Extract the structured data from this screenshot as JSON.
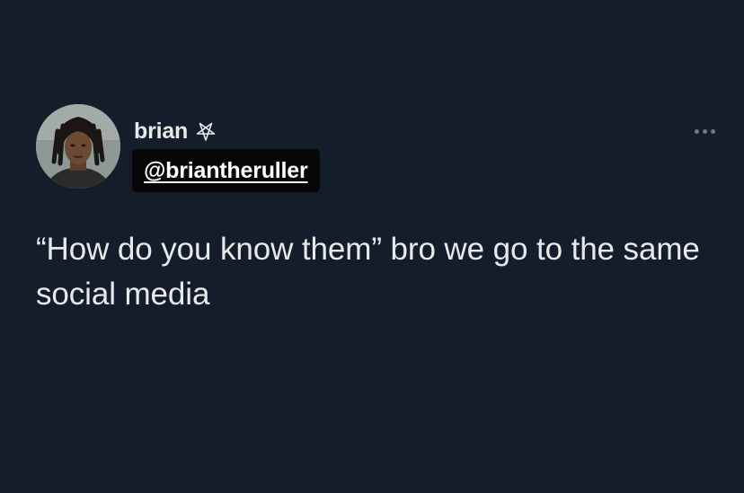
{
  "user": {
    "display_name": "brian",
    "badge_icon": "pentagram-icon",
    "handle": "@briantheruller"
  },
  "tweet": {
    "text": "“How do you know them” bro we go to the same social media"
  },
  "menu": {
    "more_icon": "more-horizontal-icon"
  },
  "colors": {
    "background": "#151d2a",
    "text": "#e7e9ea",
    "handle_chip": "#070707",
    "muted": "#6f7a87"
  }
}
